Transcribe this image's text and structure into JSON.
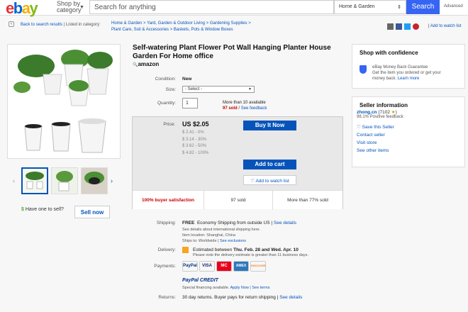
{
  "header": {
    "logo_letters": [
      "e",
      "b",
      "a",
      "y"
    ],
    "logo_colors": [
      "#e53238",
      "#0064d2",
      "#f5af02",
      "#86b817"
    ],
    "shop_by": "Shop by",
    "category": "category",
    "search_placeholder": "Search for anything",
    "category_select": "Home & Garden",
    "search_button": "Search",
    "advanced": "Advanced"
  },
  "breadcrumbs": {
    "back": "Back to search results",
    "listed_in": "| Listed in category:",
    "line1": "Home & Garden  >  Yard, Garden & Outdoor Living  >  Gardening Supplies  >",
    "line2": "Plant Care, Soil & Accessories  >  Baskets, Pots & Window Boxes"
  },
  "share": {
    "add_to_watch": "Add to watch list"
  },
  "gallery": {
    "have_one": "Have one to sell?",
    "sell_now": "Sell now"
  },
  "item": {
    "title": "Self-watering Plant Flower Pot Wall Hanging Planter House Garden For Home office",
    "brand_logo": "amazon",
    "condition_label": "Condition:",
    "condition": "New",
    "size_label": "Size:",
    "size_select": "- Select -",
    "quantity_label": "Quantity:",
    "quantity": "1",
    "available": "More than 10 available",
    "sold": "97 sold",
    "see_feedback": "See feedback",
    "price_label": "Price:",
    "price": "US $2.05",
    "tiers": [
      "$ 2.41 - 0%",
      "$ 3.14 - 30%",
      "$ 3.62 - 50%",
      "$ 4.82 - 100%"
    ],
    "buy_now": "Buy It Now",
    "add_to_cart": "Add to cart",
    "add_to_watch": "Add to watch list",
    "stat_satisfaction": "100% buyer satisfaction",
    "stat_sold": "97 sold",
    "stat_more": "More than 77% sold"
  },
  "details": {
    "shipping_label": "Shipping:",
    "shipping_free": "FREE",
    "shipping_text": "Economy Shipping from outside US |",
    "see_details": "See details",
    "intl": "See details about international shipping here.",
    "location": "Item location:  Shanghai, China",
    "ships_to": "Ships to:  Worldwide",
    "see_exclusions": "See exclusions",
    "delivery_label": "Delivery:",
    "estimated": "Estimated between",
    "dates": "Thu. Feb. 28 and Wed. Apr. 10",
    "note": "Please note the delivery estimate is greater than 11 business days.",
    "payments_label": "Payments:",
    "pay_methods": [
      "PayPal",
      "VISA",
      "MC",
      "AMEX",
      "DISCOVER"
    ],
    "paypal_credit": "PayPal CREDIT",
    "financing": "Special financing available.",
    "apply_now": "Apply Now",
    "see_terms": "See terms",
    "returns_label": "Returns:",
    "returns": "30 day returns. Buyer pays for return shipping |",
    "returns_details": "See details"
  },
  "confidence": {
    "title": "Shop with confidence",
    "mbg_title": "eBay Money Back Guarantee",
    "mbg_text1": "Get the item you ordered or get your",
    "mbg_text2": "money back.",
    "learn_more": "Learn more"
  },
  "seller": {
    "title": "Seller information",
    "name": "zhong.cn",
    "score": "(7102",
    "positive": "98.1% Positive feedback",
    "save": "Save this Seller",
    "contact": "Contact seller",
    "visit": "Visit store",
    "other": "See other items"
  }
}
